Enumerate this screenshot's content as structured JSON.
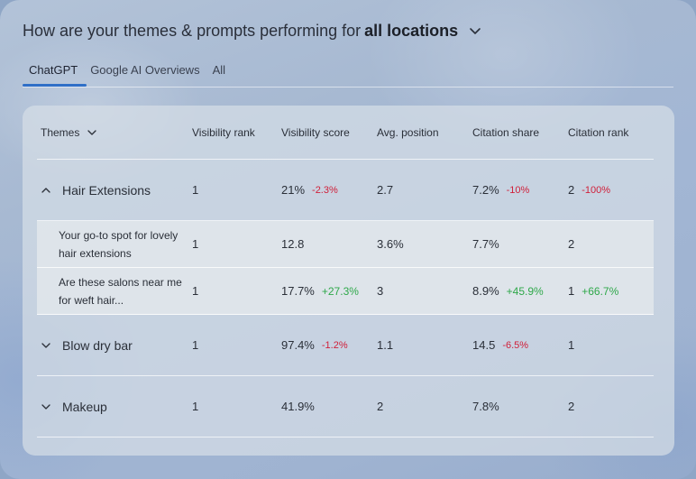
{
  "header": {
    "title_prefix": "How are your themes & prompts performing for",
    "title_location": "all locations"
  },
  "tabs": [
    {
      "label": "ChatGPT",
      "active": true
    },
    {
      "label": "Google AI Overviews",
      "active": false
    },
    {
      "label": "All",
      "active": false
    }
  ],
  "table": {
    "columns": [
      "Themes",
      "Visibility rank",
      "Visibility score",
      "Avg. position",
      "Citation share",
      "Citation rank"
    ],
    "rows": [
      {
        "type": "theme",
        "expanded": true,
        "name": "Hair Extensions",
        "visibility_rank": "1",
        "visibility_score": "21%",
        "visibility_score_delta": "-2.3%",
        "avg_position": "2.7",
        "citation_share": "7.2%",
        "citation_share_delta": "-10%",
        "citation_rank": "2",
        "citation_rank_delta": "-100%"
      },
      {
        "type": "prompt",
        "name": "Your go-to spot for lovely hair extensions",
        "visibility_rank": "1",
        "visibility_score": "12.8",
        "visibility_score_delta": "",
        "avg_position": "3.6%",
        "citation_share": "7.7%",
        "citation_share_delta": "",
        "citation_rank": "2",
        "citation_rank_delta": ""
      },
      {
        "type": "prompt",
        "name": "Are these salons near me for weft hair...",
        "visibility_rank": "1",
        "visibility_score": "17.7%",
        "visibility_score_delta": "+27.3%",
        "avg_position": "3",
        "citation_share": "8.9%",
        "citation_share_delta": "+45.9%",
        "citation_rank": "1",
        "citation_rank_delta": "+66.7%"
      },
      {
        "type": "theme",
        "expanded": false,
        "name": "Blow dry bar",
        "visibility_rank": "1",
        "visibility_score": "97.4%",
        "visibility_score_delta": "-1.2%",
        "avg_position": "1.1",
        "citation_share": "14.5",
        "citation_share_delta": "-6.5%",
        "citation_rank": "1",
        "citation_rank_delta": ""
      },
      {
        "type": "theme",
        "expanded": false,
        "name": "Makeup",
        "visibility_rank": "1",
        "visibility_score": "41.9%",
        "visibility_score_delta": "",
        "avg_position": "2",
        "citation_share": "7.8%",
        "citation_share_delta": "",
        "citation_rank": "2",
        "citation_rank_delta": ""
      }
    ]
  },
  "colors": {
    "accent": "#2f6fc7",
    "negative": "#d0203a",
    "positive": "#2fa84a"
  }
}
